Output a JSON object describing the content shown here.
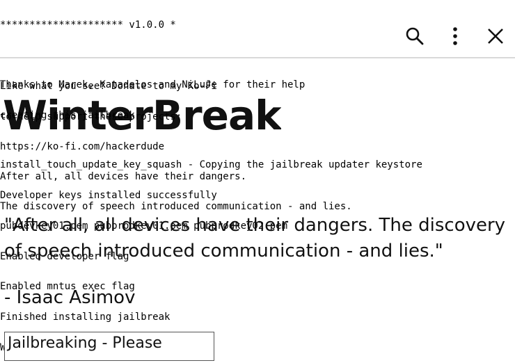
{
  "app_title": "WinterBreak",
  "header_terminal": [
    "********************* v1.0.0 *",
    "",
    "Like what you see? Donate to my Ko-Fi",
    "to help support these projects:",
    "https://ko-fi.com/hackerdude"
  ],
  "thanks_terminal": [
    "Thanks to Marek, Katadelos and NiLuJe for their help",
    "creating this jailbreak",
    "",
    "After all, all devices have their dangers.",
    "The discovery of speech introduced communication - and lies."
  ],
  "log_terminal": [
    "install_touch_update_key_squash - Copying the jailbreak updater keystore",
    "Developer keys installed successfully",
    "pubdevkey01.pem pubprodkey01.pem pubprodkey02.pem",
    "Enabled developer flag",
    "Enabled mntus exec flag",
    "Finished installing jailbreak",
    "Waiting 3 seconds to reboot..."
  ],
  "toolbar": {
    "search_icon": "search-icon",
    "menu_icon": "more-vertical-icon",
    "close_icon": "close-icon"
  },
  "quote": "\"After all, all devices have their dangers. The discovery of speech introduced communication - and lies.\"",
  "quote_author": "- Isaac Asimov",
  "status_label": "Jailbreaking - Please"
}
